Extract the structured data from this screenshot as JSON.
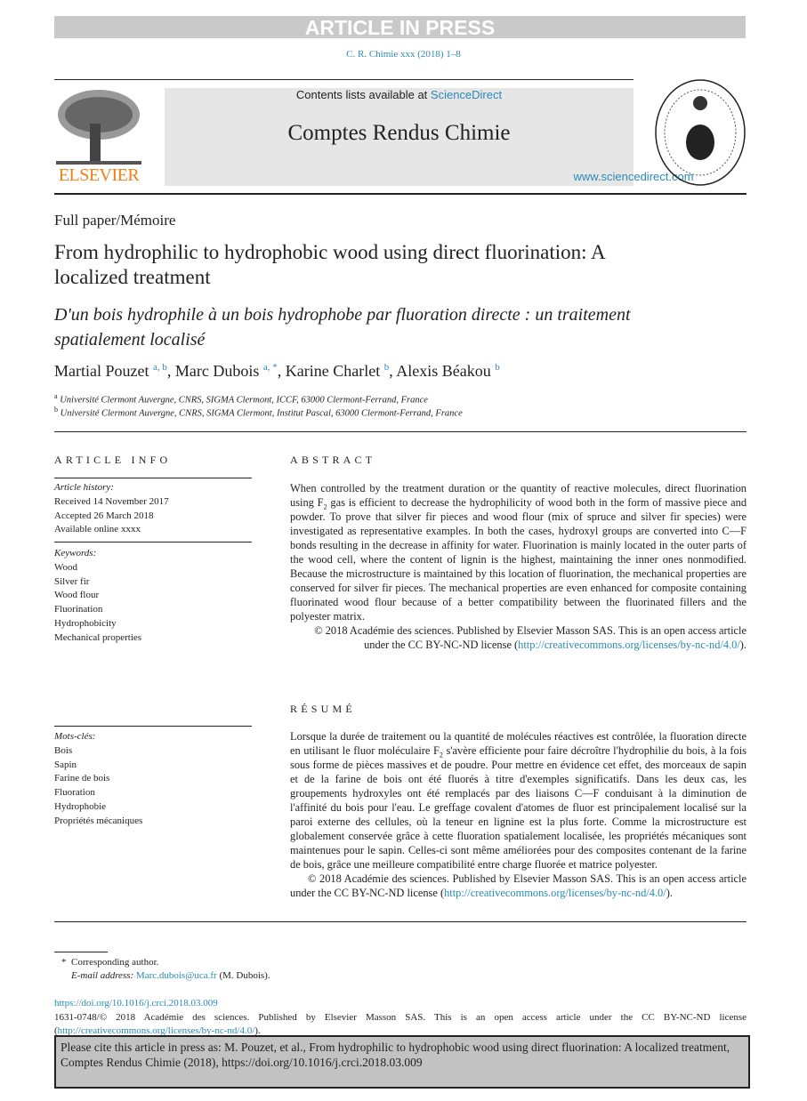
{
  "banner": "ARTICLE IN PRESS",
  "journal_ref": "C. R. Chimie xxx (2018) 1–8",
  "header": {
    "contents_prefix": "Contents lists available at ",
    "contents_link": "ScienceDirect",
    "journal_name": "Comptes Rendus Chimie",
    "url": "www.sciencedirect.com",
    "publisher_logo": "ELSEVIER",
    "seal_text": "INSTITUT DE FRANCE ACADÉMIE DES SCIENCES 1666"
  },
  "article_type": "Full paper/Mémoire",
  "title": "From hydrophilic to hydrophobic wood using direct fluorination: A localized treatment",
  "title_fr": "D'un bois hydrophile à un bois hydrophobe par fluoration directe : un traitement spatialement localisé",
  "authors": [
    {
      "name": "Martial Pouzet",
      "aff": "a, b",
      "sep": ", "
    },
    {
      "name": "Marc Dubois",
      "aff": "a, *",
      "sep": ", "
    },
    {
      "name": "Karine Charlet",
      "aff": "b",
      "sep": ", "
    },
    {
      "name": "Alexis Béakou",
      "aff": "b",
      "sep": ""
    }
  ],
  "affiliations": [
    {
      "mark": "a",
      "text": "Université Clermont Auvergne, CNRS, SIGMA Clermont, ICCF, 63000 Clermont-Ferrand, France"
    },
    {
      "mark": "b",
      "text": "Université Clermont Auvergne, CNRS, SIGMA Clermont, Institut Pascal, 63000 Clermont-Ferrand, France"
    }
  ],
  "article_info": {
    "heading": "ARTICLE INFO",
    "history_label": "Article history:",
    "history": [
      "Received 14 November 2017",
      "Accepted 26 March 2018",
      "Available online xxxx"
    ],
    "keywords_label": "Keywords:",
    "keywords": [
      "Wood",
      "Silver fir",
      "Wood flour",
      "Fluorination",
      "Hydrophobicity",
      "Mechanical properties"
    ],
    "motscles_label": "Mots-clés:",
    "motscles": [
      "Bois",
      "Sapin",
      "Farine de bois",
      "Fluoration",
      "Hydrophobie",
      "Propriétés mécaniques"
    ]
  },
  "abstract": {
    "heading": "ABSTRACT",
    "text_a": "When controlled by the treatment duration or the quantity of reactive molecules, direct fluorination using F",
    "sub": "2",
    "text_b": " gas is efficient to decrease the hydrophilicity of wood both in the form of massive piece and powder. To prove that silver fir pieces and wood flour (mix of spruce and silver fir species) were investigated as representative examples. In both the cases, hydroxyl groups are converted into C—F bonds resulting in the decrease in affinity for water. Fluorination is mainly located in the outer parts of the wood cell, where the content of lignin is the highest, maintaining the inner ones nonmodified. Because the microstructure is maintained by this location of fluorination, the mechanical properties are conserved for silver fir pieces. The mechanical properties are even enhanced for composite containing fluorinated wood flour because of a better compatibility between the fluorinated fillers and the polyester matrix.",
    "copyright": "© 2018 Académie des sciences. Published by Elsevier Masson SAS. This is an open access article under the CC BY-NC-ND license (",
    "license_url": "http://creativecommons.org/licenses/by-nc-nd/4.0/",
    "copyright_end": ")."
  },
  "resume": {
    "heading": "RÉSUMÉ",
    "text_a": "Lorsque la durée de traitement ou la quantité de molécules réactives est contrôlée, la fluoration directe en utilisant le fluor moléculaire F",
    "sub": "2",
    "text_b": " s'avère efficiente pour faire décroître l'hydrophilie du bois, à la fois sous forme de pièces massives et de poudre. Pour mettre en évidence cet effet, des morceaux de sapin et de la farine de bois ont été fluorés à titre d'exemples significatifs. Dans les deux cas, les groupements hydroxyles ont été remplacés par des liaisons C—F conduisant à la diminution de l'affinité du bois pour l'eau. Le greffage covalent d'atomes de fluor est principalement localisé sur la paroi externe des cellules, où la teneur en lignine est la plus forte. Comme la microstructure est globalement conservée grâce à cette fluoration spatialement localisée, les propriétés mécaniques sont maintenues pour le sapin. Celles-ci sont même améliorées pour des composites contenant de la farine de bois, grâce une meilleure compatibilité entre charge fluorée et matrice polyester.",
    "copyright": "© 2018 Académie des sciences. Published by Elsevier Masson SAS. This is an open access article under the CC BY-NC-ND license (",
    "license_url": "http://creativecommons.org/licenses/by-nc-nd/4.0/",
    "copyright_end": ")."
  },
  "footnote": {
    "star": "*",
    "corresponding": "Corresponding author.",
    "email_label": "E-mail address:",
    "email": "Marc.dubois@uca.fr",
    "email_name": "(M. Dubois)."
  },
  "doi": {
    "url": "https://doi.org/10.1016/j.crci.2018.03.009",
    "issn_text": "1631-0748/© 2018 Académie des sciences. Published by Elsevier Masson SAS. This is an open access article under the CC BY-NC-ND license (",
    "license_url": "http://creativecommons.org/licenses/by-nc-nd/4.0/",
    "end": ")."
  },
  "cite_box": "Please cite this article in press as: M. Pouzet, et al., From hydrophilic to hydrophobic wood using direct fluorination: A localized treatment, Comptes Rendus Chimie (2018), https://doi.org/10.1016/j.crci.2018.03.009",
  "colors": {
    "link": "#2a8ab8",
    "elsevier": "#f07f1a",
    "banner": "#c9c9c9",
    "header_box": "#e6e6e6",
    "cite_box": "#c2c2c2"
  }
}
